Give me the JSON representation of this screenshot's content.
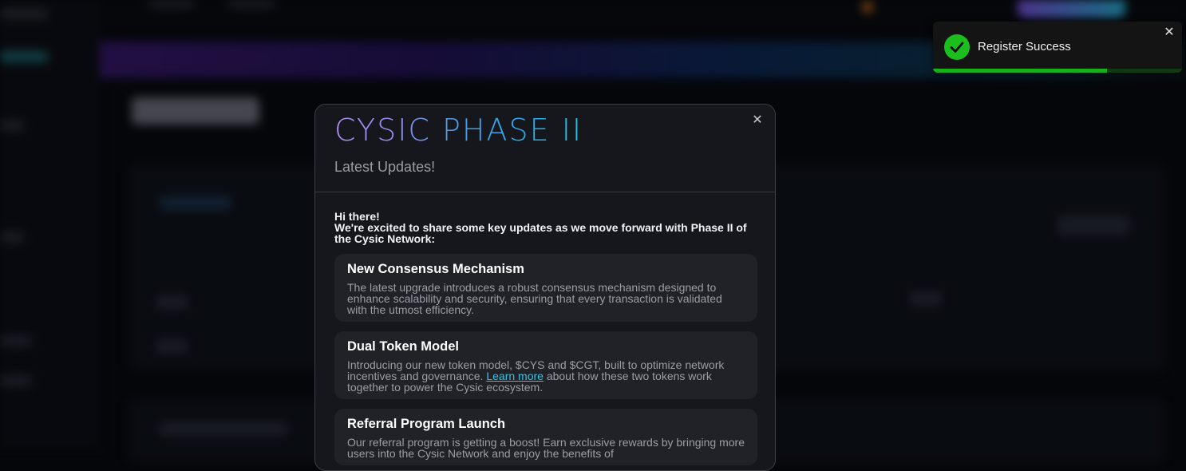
{
  "modal": {
    "title": "CYSIC PHASE II",
    "subtitle": "Latest Updates!",
    "close_icon": "close-icon",
    "intro_line1": "Hi there!",
    "intro_line2": "We're excited to share some key updates as we move forward with Phase II of the Cysic Network:",
    "updates": [
      {
        "title": "New Consensus Mechanism",
        "description": "The latest upgrade introduces a robust consensus mechanism designed to enhance scalability and security, ensuring that every transaction is validated with the utmost efficiency."
      },
      {
        "title": "Dual Token Model",
        "description_before": "Introducing our new token model, $CYS and $CGT, built to optimize network incentives and governance. ",
        "link_label": "Learn more",
        "description_after": " about how these two tokens work together to power the Cysic ecosystem."
      },
      {
        "title": "Referral Program Launch",
        "description": "Our referral program is getting a boost! Earn exclusive rewards by bringing more users into the Cysic Network and enjoy the benefits of"
      }
    ]
  },
  "toast": {
    "message": "Register Success",
    "icon": "check-circle-icon",
    "close_icon": "close-icon",
    "progress": 0.7
  },
  "colors": {
    "success": "#1bbf1b",
    "link": "#2fc5e8",
    "title_gradient_start": "#b08cf5",
    "title_gradient_end": "#22c3e6"
  }
}
